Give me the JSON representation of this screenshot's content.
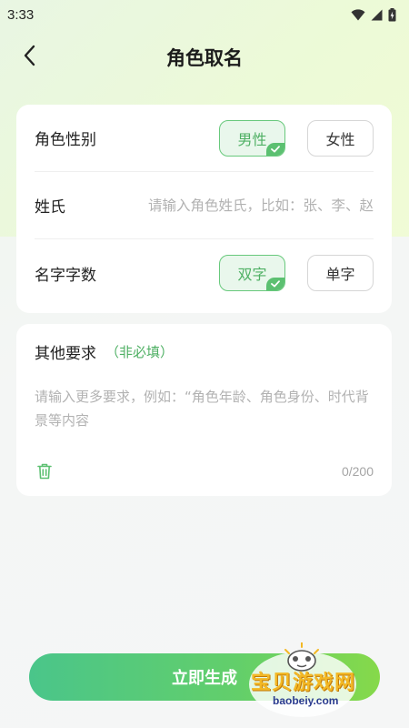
{
  "status_bar": {
    "time": "3:33"
  },
  "nav": {
    "title": "角色取名"
  },
  "form": {
    "gender": {
      "label": "角色性别",
      "options": [
        {
          "label": "男性",
          "selected": true
        },
        {
          "label": "女性",
          "selected": false
        }
      ]
    },
    "surname": {
      "label": "姓氏",
      "value": "",
      "placeholder": "请输入角色姓氏，比如：张、李、赵"
    },
    "name_length": {
      "label": "名字字数",
      "options": [
        {
          "label": "双字",
          "selected": true
        },
        {
          "label": "单字",
          "selected": false
        }
      ]
    }
  },
  "extra": {
    "title": "其他要求",
    "optional_tag": "（非必填）",
    "value": "",
    "placeholder": "请输入更多要求，例如：“角色年龄、角色身份、时代背景等内容",
    "counter": "0/200"
  },
  "actions": {
    "generate_label": "立即生成"
  },
  "watermark": {
    "brand": "宝贝游戏网",
    "url": "baobeiy.com"
  },
  "colors": {
    "accent": "#4fb064",
    "selected_bg": "#e9f7ec",
    "button_start": "#4ac58a",
    "button_end": "#86d94a"
  },
  "icons": {
    "back": "chevron-left-icon",
    "selected": "check-icon",
    "clear": "trash-icon"
  }
}
